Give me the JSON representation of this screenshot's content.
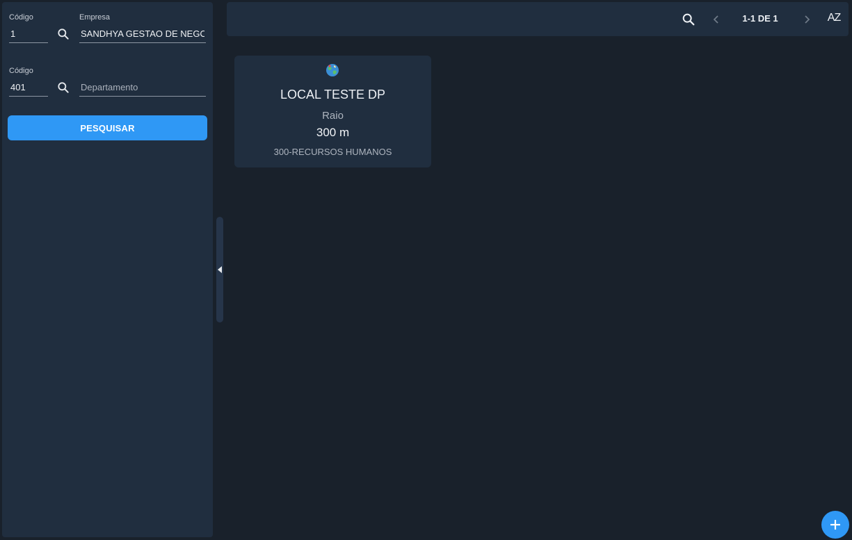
{
  "filters": {
    "empresa": {
      "code_label": "Código",
      "code_value": "1",
      "name_label": "Empresa",
      "name_value": "SANDHYA GESTAO DE NEGOC",
      "search_icon": "search-icon"
    },
    "departamento": {
      "code_label": "Código",
      "code_value": "401",
      "name_placeholder": "Departamento",
      "search_icon": "search-icon"
    },
    "search_button_label": "PESQUISAR"
  },
  "toolbar": {
    "search_icon": "search-icon",
    "prev_icon": "chevron-left-icon",
    "next_icon": "chevron-right-icon",
    "pagination": "1-1 DE 1",
    "sort_label": "AZ"
  },
  "cards": [
    {
      "icon": "globe-icon",
      "title": "LOCAL TESTE DP",
      "radius_label": "Raio",
      "radius_value": "300 m",
      "department": "300-RECURSOS HUMANOS"
    }
  ],
  "fab_icon": "plus-icon",
  "colors": {
    "background": "#19212b",
    "panel": "#202e3f",
    "accent": "#2f98f5"
  }
}
